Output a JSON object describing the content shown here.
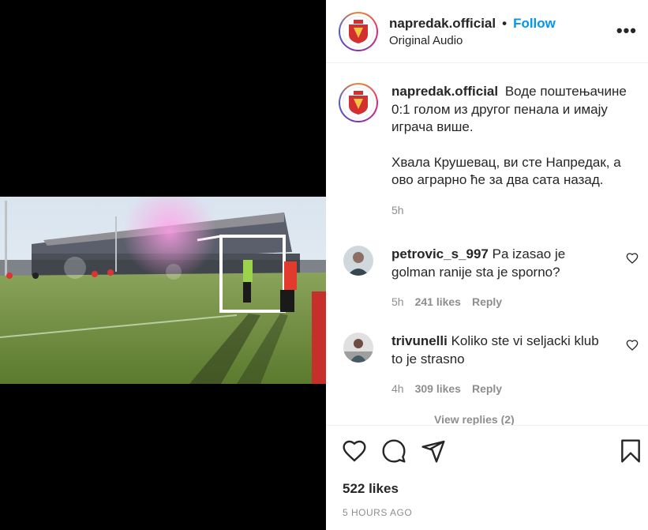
{
  "post": {
    "username": "napredak.official",
    "follow_label": "Follow",
    "separator": "•",
    "audio": "Original Audio",
    "more_label": "•••"
  },
  "caption": {
    "username": "napredak.official",
    "text_p1": "Воде поштењачине 0:1 голом из другог пенала и имају играча више.",
    "text_p2": "Хвала Крушевац, ви сте Напредак, а ово аграрно ће за два сата назад.",
    "time": "5h"
  },
  "comments": [
    {
      "username": "petrovic_s_997",
      "text": "Pa izasao je golman ranije sta je sporno?",
      "time": "5h",
      "likes": "241 likes",
      "reply": "Reply"
    },
    {
      "username": "trivunelli",
      "text": "Koliko ste vi seljacki klub to je strasno",
      "time": "4h",
      "likes": "309 likes",
      "reply": "Reply"
    }
  ],
  "view_replies": "View replies (2)",
  "footer": {
    "likes": "522 likes",
    "time_ago": "5 HOURS AGO"
  },
  "colors": {
    "link_blue": "#0095f6",
    "muted": "#8e8e8e",
    "text": "#262626"
  }
}
